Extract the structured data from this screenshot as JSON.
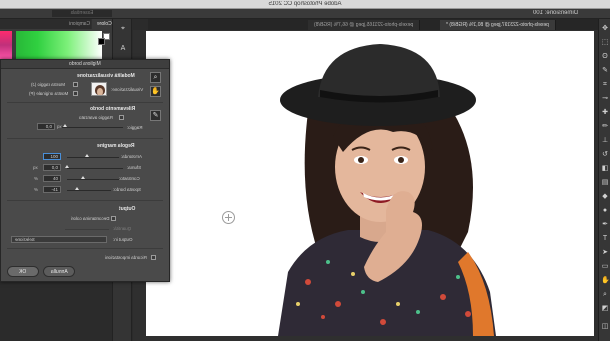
{
  "window": {
    "title": "Adobe Photoshop CC 2015"
  },
  "options_bar": {
    "essentials": "Essentials",
    "workspace_label": "Dimensione: 100"
  },
  "tabs": [
    {
      "label": "pexels-photo-221165.jpeg @ 66,7% (RGB/8)"
    },
    {
      "label": "pexels-photo-223197.jpeg @ 80,1% (RGB/8) *"
    }
  ],
  "color_panel": {
    "tab_color": "Colore",
    "tab_swatches": "Campioni"
  },
  "dialog": {
    "title": "Migliora bordo",
    "view_mode": {
      "heading": "Modalità visualizzazione",
      "view_label": "Visualizzazione:",
      "show_radius": "Mostra raggio (J)",
      "show_original": "Mostra originale (P)"
    },
    "edge_detection": {
      "heading": "Rilevamento bordo",
      "smart_radius": "Raggio avanzato",
      "radius_label": "Raggio:",
      "radius_value": "0,0",
      "radius_unit": "px"
    },
    "adjust_edge": {
      "heading": "Regola margine",
      "smooth_label": "Arrotonda:",
      "smooth_value": "100",
      "feather_label": "Sfuma:",
      "feather_value": "0,0",
      "feather_unit": "px",
      "contrast_label": "Contrasto:",
      "contrast_value": "40",
      "contrast_unit": "%",
      "shift_label": "Sposta bordo:",
      "shift_value": "-41",
      "shift_unit": "%"
    },
    "output": {
      "heading": "Output",
      "decontaminate": "Decontamina colori",
      "amount_label": "Quantità:",
      "output_to_label": "Output in:",
      "output_to_value": "Selezione"
    },
    "remember": "Ricorda impostazioni",
    "cancel": "Annulla",
    "ok": "OK"
  },
  "colors": {
    "panel_bg": "#4a4a4a",
    "canvas_bg": "#ffffff",
    "app_bg": "#2b2b2b"
  }
}
